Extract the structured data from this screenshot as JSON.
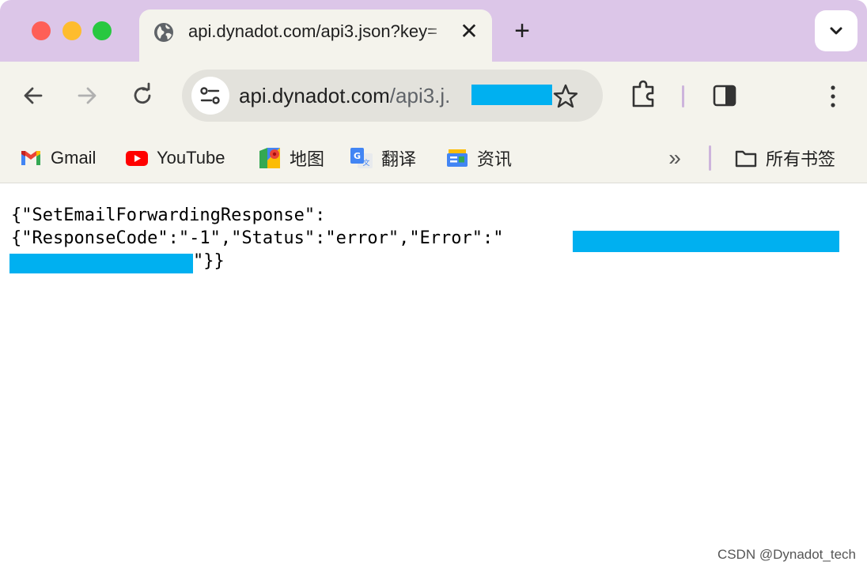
{
  "window": {
    "tab": {
      "title": "api.dynadot.com/api3.json?key=",
      "close_glyph": "✕",
      "icon": "globe-icon"
    },
    "new_tab_glyph": "+",
    "tab_search_icon": "chevron-down-icon",
    "traffic_colors": {
      "close": "#fe5f57",
      "minimize": "#febc2e",
      "zoom": "#28c840"
    }
  },
  "toolbar": {
    "back_icon": "arrow-left-icon",
    "forward_icon": "arrow-right-icon",
    "reload_icon": "reload-icon",
    "omnibox": {
      "host": "api.dynadot.com",
      "path": "/api3.j.",
      "star_icon": "star-icon",
      "site_info_icon": "tune-icon"
    },
    "extensions_icon": "puzzle-icon",
    "side_panel_icon": "side-panel-icon",
    "menu_icon": "kebab-menu-icon"
  },
  "bookmarks": {
    "items": [
      {
        "label": "Gmail",
        "icon": "gmail-icon"
      },
      {
        "label": "YouTube",
        "icon": "youtube-icon"
      },
      {
        "label": "地图",
        "icon": "maps-icon"
      },
      {
        "label": "翻译",
        "icon": "translate-icon"
      },
      {
        "label": "资讯",
        "icon": "news-icon"
      }
    ],
    "more_glyph": "»",
    "all_bookmarks": {
      "label": "所有书签",
      "icon": "folder-icon"
    }
  },
  "content": {
    "line1": "{\"SetEmailForwardingResponse\":",
    "line2": "{\"ResponseCode\":\"-1\",\"Status\":\"error\",\"Error\":\"",
    "line3_tail": "\"}}",
    "redaction_color": "#00b0f0"
  },
  "watermark": "CSDN @Dynadot_tech",
  "colors": {
    "tabstrip": "#dcc6e8",
    "toolbar": "#f4f3ec",
    "omnibox": "#e3e2dc"
  }
}
